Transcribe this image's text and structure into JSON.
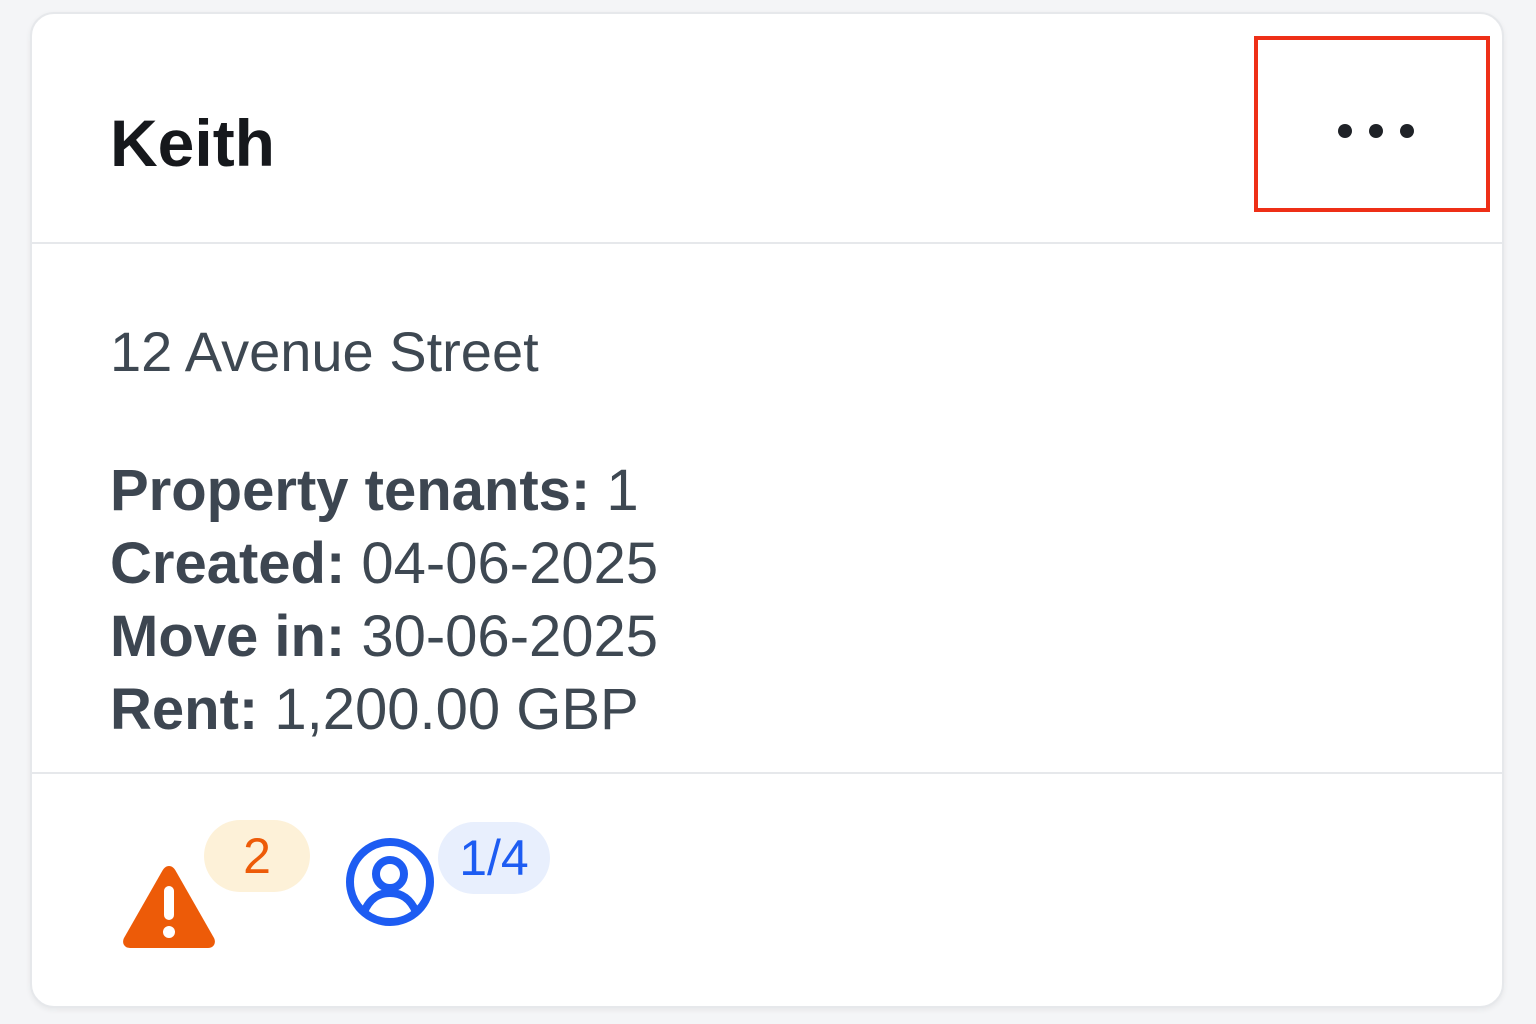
{
  "card": {
    "title": "Keith",
    "menu_icon": "more-horizontal-icon",
    "address": "12 Avenue Street",
    "details": [
      {
        "label": "Property tenants:",
        "value": " 1"
      },
      {
        "label": "Created:",
        "value": " 04-06-2025"
      },
      {
        "label": "Move in:",
        "value": " 30-06-2025"
      },
      {
        "label": "Rent:",
        "value": " 1,200.00 GBP"
      }
    ],
    "alerts": {
      "icon": "warning-triangle-icon",
      "count": "2",
      "color": "#ed5b08",
      "badge_bg": "#fdf1d8"
    },
    "tenants": {
      "icon": "user-circle-icon",
      "count": "1/4",
      "color": "#1d5cf2",
      "badge_bg": "#e8effd"
    },
    "highlight_color": "#ee2f17"
  }
}
